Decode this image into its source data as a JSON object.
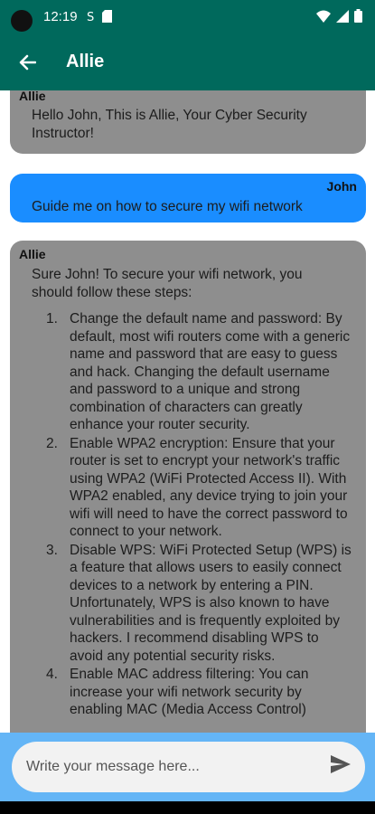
{
  "status_bar": {
    "time": "12:19"
  },
  "app_bar": {
    "title": "Allie"
  },
  "messages": [
    {
      "sender": "Allie",
      "text": "Hello John, This is Allie, Your Cyber Security Instructor!"
    },
    {
      "sender": "John",
      "text": "Guide me on how to secure my wifi network"
    },
    {
      "sender": "Allie",
      "text": "Sure John! To secure your wifi network, you should follow these steps:",
      "steps": [
        {
          "num": "1.",
          "text": "Change the default name and password: By default, most wifi routers come with a generic name and password that are easy to guess and hack. Changing the default username and password to a unique and strong combination of characters can greatly enhance your router security."
        },
        {
          "num": "2.",
          "text": "Enable WPA2 encryption: Ensure that your router is set to encrypt your network's traffic using WPA2 (WiFi Protected Access II). With WPA2 enabled, any device trying to join your wifi will need to have the correct password to connect to your network."
        },
        {
          "num": "3.",
          "text": "Disable WPS: WiFi Protected Setup (WPS) is a feature that allows users to easily connect devices to a network by entering a PIN. Unfortunately, WPS is also known to have vulnerabilities and is frequently exploited by hackers. I recommend disabling WPS to avoid any potential security risks."
        },
        {
          "num": "4.",
          "text": "Enable MAC address filtering: You can increase your wifi network security by enabling MAC (Media Access Control)"
        }
      ]
    }
  ],
  "composer": {
    "placeholder": "Write your message here..."
  },
  "colors": {
    "app_bar": "#00695c",
    "bot_bubble": "#8e8e8e",
    "user_bubble": "#1a8dff",
    "input_bar": "#64b5f6"
  },
  "icons": {
    "back": "arrow-left",
    "send": "send",
    "signal": "cellular",
    "wifi": "wifi",
    "battery": "battery"
  }
}
